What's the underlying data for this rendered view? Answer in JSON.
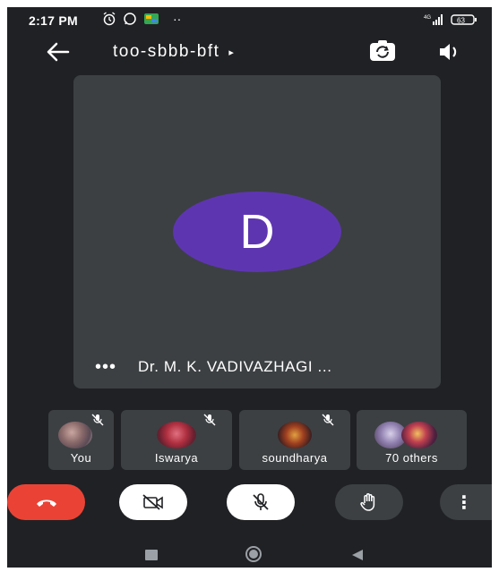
{
  "status_bar": {
    "time": "2:17 PM",
    "battery": "63",
    "network": "4G",
    "icons": [
      "alarm-icon",
      "whatsapp-icon",
      "message-icon",
      "more-notifications-icon"
    ]
  },
  "header": {
    "meeting_code": "too-sbbb-bft",
    "chevron": "▸"
  },
  "main_tile": {
    "avatar_letter": "D",
    "avatar_color": "#5e35b1",
    "dots": "•••",
    "participant_name": "Dr. M. K. VADIVAZHAGI ..."
  },
  "participants": [
    {
      "label": "You"
    },
    {
      "label": "Iswarya"
    },
    {
      "label": "soundharya"
    },
    {
      "label": "70 others"
    }
  ],
  "controls": {
    "end_call_color": "#ea4335",
    "more_glyph": "⋮"
  },
  "colors": {
    "background": "#202124",
    "tile": "#3c4043",
    "control_dark": "#3c4043",
    "control_light": "#ffffff"
  }
}
